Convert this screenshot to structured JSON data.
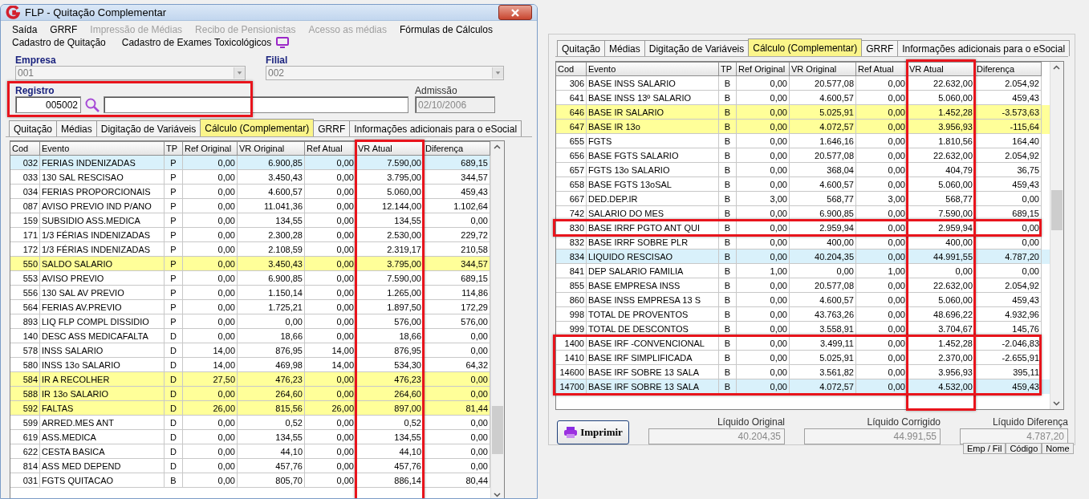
{
  "left_window": {
    "title": "FLP - Quitação Complementar",
    "menu": [
      {
        "label": "Saída",
        "disabled": false
      },
      {
        "label": "GRRF",
        "disabled": false
      },
      {
        "label": "Impressão de Médias",
        "disabled": true
      },
      {
        "label": "Recibo de Pensionistas",
        "disabled": true
      },
      {
        "label": "Acesso as médias",
        "disabled": true
      },
      {
        "label": "Fórmulas de Cálculos",
        "disabled": false
      }
    ],
    "links": [
      "Cadastro de Quitação",
      "Cadastro de Exames Toxicológicos"
    ],
    "empresa": {
      "label": "Empresa",
      "value": "001"
    },
    "filial": {
      "label": "Filial",
      "value": "002"
    },
    "registro": {
      "label": "Registro",
      "value": "005002",
      "boxed": true
    },
    "admissao": {
      "label": "Admissão",
      "value": "02/10/2006"
    },
    "tabs": [
      {
        "label": "Quitação",
        "selected": false
      },
      {
        "label": "Médias",
        "selected": false
      },
      {
        "label": "Digitação de Variáveis",
        "selected": false
      },
      {
        "label": "Cálculo (Complementar)",
        "selected": true
      },
      {
        "label": "GRRF",
        "selected": false
      },
      {
        "label": "Informações adicionais para o eSocial",
        "selected": false
      }
    ],
    "table": {
      "columns": [
        {
          "label": "Cod",
          "boxed": false
        },
        {
          "label": "Evento",
          "boxed": false
        },
        {
          "label": "TP",
          "boxed": false
        },
        {
          "label": "Ref Original",
          "boxed": false
        },
        {
          "label": "VR Original",
          "boxed": false
        },
        {
          "label": "Ref Atual",
          "boxed": false
        },
        {
          "label": "VR Atual",
          "boxed": true
        },
        {
          "label": "Diferença",
          "boxed": false
        }
      ],
      "rows": [
        {
          "cells": [
            "032",
            "FERIAS INDENIZADAS",
            "P",
            "0,00",
            "6.900,85",
            "0,00",
            "7.590,00",
            "689,15"
          ],
          "color": "#d9f1fb"
        },
        {
          "cells": [
            "033",
            "130 SAL RESCISAO",
            "P",
            "0,00",
            "3.450,43",
            "0,00",
            "3.795,00",
            "344,57"
          ],
          "color": "#ffffff"
        },
        {
          "cells": [
            "034",
            "FERIAS PROPORCIONAIS",
            "P",
            "0,00",
            "4.600,57",
            "0,00",
            "5.060,00",
            "459,43"
          ],
          "color": "#ffffff"
        },
        {
          "cells": [
            "087",
            "AVISO PREVIO IND P/ANO",
            "P",
            "0,00",
            "11.041,36",
            "0,00",
            "12.144,00",
            "1.102,64"
          ],
          "color": "#ffffff"
        },
        {
          "cells": [
            "159",
            "SUBSIDIO ASS.MEDICA",
            "P",
            "0,00",
            "134,55",
            "0,00",
            "134,55",
            "0,00"
          ],
          "color": "#ffffff"
        },
        {
          "cells": [
            "171",
            "1/3 FÉRIAS INDENIZADAS",
            "P",
            "0,00",
            "2.300,28",
            "0,00",
            "2.530,00",
            "229,72"
          ],
          "color": "#ffffff"
        },
        {
          "cells": [
            "172",
            "1/3 FÉRIAS INDENIZADAS",
            "P",
            "0,00",
            "2.108,59",
            "0,00",
            "2.319,17",
            "210,58"
          ],
          "color": "#ffffff"
        },
        {
          "cells": [
            "550",
            "SALDO SALARIO",
            "P",
            "0,00",
            "3.450,43",
            "0,00",
            "3.795,00",
            "344,57"
          ],
          "color": "#ffff99"
        },
        {
          "cells": [
            "553",
            "AVISO PREVIO",
            "P",
            "0,00",
            "6.900,85",
            "0,00",
            "7.590,00",
            "689,15"
          ],
          "color": "#ffffff"
        },
        {
          "cells": [
            "556",
            "130 SAL AV PREVIO",
            "P",
            "0,00",
            "1.150,14",
            "0,00",
            "1.265,00",
            "114,86"
          ],
          "color": "#ffffff"
        },
        {
          "cells": [
            "564",
            "FERIAS AV.PREVIO",
            "P",
            "0,00",
            "1.725,21",
            "0,00",
            "1.897,50",
            "172,29"
          ],
          "color": "#ffffff"
        },
        {
          "cells": [
            "893",
            "LIQ FLP COMPL DISSIDIO",
            "P",
            "0,00",
            "0,00",
            "0,00",
            "576,00",
            "576,00"
          ],
          "color": "#ffffff"
        },
        {
          "cells": [
            "140",
            "DESC ASS MEDICAFALTA",
            "D",
            "0,00",
            "18,66",
            "0,00",
            "18,66",
            "0,00"
          ],
          "color": "#ffffff"
        },
        {
          "cells": [
            "578",
            "INSS SALARIO",
            "D",
            "14,00",
            "876,95",
            "14,00",
            "876,95",
            "0,00"
          ],
          "color": "#ffffff"
        },
        {
          "cells": [
            "580",
            "INSS 13o SALARIO",
            "D",
            "14,00",
            "469,98",
            "14,00",
            "534,30",
            "64,32"
          ],
          "color": "#ffffff"
        },
        {
          "cells": [
            "584",
            "IR A RECOLHER",
            "D",
            "27,50",
            "476,23",
            "0,00",
            "476,23",
            "0,00"
          ],
          "color": "#ffff99"
        },
        {
          "cells": [
            "588",
            "IR 13o SALARIO",
            "D",
            "0,00",
            "264,60",
            "0,00",
            "264,60",
            "0,00"
          ],
          "color": "#ffff99"
        },
        {
          "cells": [
            "592",
            "FALTAS",
            "D",
            "26,00",
            "815,56",
            "26,00",
            "897,00",
            "81,44"
          ],
          "color": "#ffff99"
        },
        {
          "cells": [
            "599",
            "ARRED.MES ANT",
            "D",
            "0,00",
            "0,52",
            "0,00",
            "0,52",
            "0,00"
          ],
          "color": "#ffffff"
        },
        {
          "cells": [
            "619",
            "ASS.MEDICA",
            "D",
            "0,00",
            "134,55",
            "0,00",
            "134,55",
            "0,00"
          ],
          "color": "#ffffff"
        },
        {
          "cells": [
            "622",
            "CESTA BASICA",
            "D",
            "0,00",
            "44,10",
            "0,00",
            "44,10",
            "0,00"
          ],
          "color": "#ffffff"
        },
        {
          "cells": [
            "814",
            "ASS MED DEPEND",
            "D",
            "0,00",
            "457,76",
            "0,00",
            "457,76",
            "0,00"
          ],
          "color": "#ffffff"
        },
        {
          "cells": [
            "031",
            "FGTS QUITACAO",
            "B",
            "0,00",
            "805,70",
            "0,00",
            "886,14",
            "80,44"
          ],
          "color": "#ffffff"
        }
      ]
    }
  },
  "right_panel": {
    "tabs": [
      {
        "label": "Quitação",
        "selected": false
      },
      {
        "label": "Médias",
        "selected": false
      },
      {
        "label": "Digitação de Variáveis",
        "selected": false
      },
      {
        "label": "Cálculo (Complementar)",
        "selected": true
      },
      {
        "label": "GRRF",
        "selected": false
      },
      {
        "label": "Informações adicionais para o eSocial",
        "selected": false
      }
    ],
    "table": {
      "columns": [
        {
          "label": "Cod",
          "boxed": false
        },
        {
          "label": "Evento",
          "boxed": false
        },
        {
          "label": "TP",
          "boxed": false
        },
        {
          "label": "Ref Original",
          "boxed": false
        },
        {
          "label": "VR Original",
          "boxed": false
        },
        {
          "label": "Ref Atual",
          "boxed": false
        },
        {
          "label": "VR Atual",
          "boxed": true
        },
        {
          "label": "Diferença",
          "boxed": false
        }
      ],
      "rows": [
        {
          "cells": [
            "306",
            "BASE INSS SALARIO",
            "B",
            "0,00",
            "20.577,08",
            "0,00",
            "22.632,00",
            "2.054,92"
          ],
          "color": "#ffffff",
          "boxed": false
        },
        {
          "cells": [
            "641",
            "BASE INSS 13º SALARIO",
            "B",
            "0,00",
            "4.600,57",
            "0,00",
            "5.060,00",
            "459,43"
          ],
          "color": "#ffffff",
          "boxed": false
        },
        {
          "cells": [
            "646",
            "BASE IR SALARIO",
            "B",
            "0,00",
            "5.025,91",
            "0,00",
            "1.452,28",
            "-3.573,63"
          ],
          "color": "#ffff99",
          "boxed": false
        },
        {
          "cells": [
            "647",
            "BASE IR 13o",
            "B",
            "0,00",
            "4.072,57",
            "0,00",
            "3.956,93",
            "-115,64"
          ],
          "color": "#ffff99",
          "boxed": false
        },
        {
          "cells": [
            "655",
            "FGTS",
            "B",
            "0,00",
            "1.646,16",
            "0,00",
            "1.810,56",
            "164,40"
          ],
          "color": "#ffffff",
          "boxed": false
        },
        {
          "cells": [
            "656",
            "BASE FGTS SALARIO",
            "B",
            "0,00",
            "20.577,08",
            "0,00",
            "22.632,00",
            "2.054,92"
          ],
          "color": "#ffffff",
          "boxed": false
        },
        {
          "cells": [
            "657",
            "FGTS 13o SALARIO",
            "B",
            "0,00",
            "368,04",
            "0,00",
            "404,79",
            "36,75"
          ],
          "color": "#ffffff",
          "boxed": false
        },
        {
          "cells": [
            "658",
            "BASE FGTS 13oSAL",
            "B",
            "0,00",
            "4.600,57",
            "0,00",
            "5.060,00",
            "459,43"
          ],
          "color": "#ffffff",
          "boxed": false
        },
        {
          "cells": [
            "667",
            "DED.DEP.IR",
            "B",
            "3,00",
            "568,77",
            "3,00",
            "568,77",
            "0,00"
          ],
          "color": "#ffffff",
          "boxed": false
        },
        {
          "cells": [
            "742",
            "SALARIO DO MES",
            "B",
            "0,00",
            "6.900,85",
            "0,00",
            "7.590,00",
            "689,15"
          ],
          "color": "#ffffff",
          "boxed": false
        },
        {
          "cells": [
            "830",
            "BASE IRRF PGTO ANT QUI",
            "B",
            "0,00",
            "2.959,94",
            "0,00",
            "2.959,94",
            "0,00"
          ],
          "color": "#ffffff",
          "boxed": true
        },
        {
          "cells": [
            "832",
            "BASE IRRF SOBRE PLR",
            "B",
            "0,00",
            "400,00",
            "0,00",
            "400,00",
            "0,00"
          ],
          "color": "#ffffff",
          "boxed": false
        },
        {
          "cells": [
            "834",
            "LIQUIDO RESCISAO",
            "B",
            "0,00",
            "40.204,35",
            "0,00",
            "44.991,55",
            "4.787,20"
          ],
          "color": "#d9f1fb",
          "boxed": false
        },
        {
          "cells": [
            "841",
            "DEP SALARIO FAMILIA",
            "B",
            "1,00",
            "0,00",
            "1,00",
            "0,00",
            "0,00"
          ],
          "color": "#ffffff",
          "boxed": false
        },
        {
          "cells": [
            "855",
            "BASE EMPRESA INSS",
            "B",
            "0,00",
            "20.577,08",
            "0,00",
            "22.632,00",
            "2.054,92"
          ],
          "color": "#ffffff",
          "boxed": false
        },
        {
          "cells": [
            "860",
            "BASE INSS EMPRESA 13 S",
            "B",
            "0,00",
            "4.600,57",
            "0,00",
            "5.060,00",
            "459,43"
          ],
          "color": "#ffffff",
          "boxed": false
        },
        {
          "cells": [
            "998",
            "TOTAL DE PROVENTOS",
            "B",
            "0,00",
            "43.763,26",
            "0,00",
            "48.696,22",
            "4.932,96"
          ],
          "color": "#ffffff",
          "boxed": false
        },
        {
          "cells": [
            "999",
            "TOTAL DE DESCONTOS",
            "B",
            "0,00",
            "3.558,91",
            "0,00",
            "3.704,67",
            "145,76"
          ],
          "color": "#ffffff",
          "boxed": false
        },
        {
          "cells": [
            "1400",
            "BASE IRF -CONVENCIONAL",
            "B",
            "0,00",
            "3.499,11",
            "0,00",
            "1.452,28",
            "-2.046,83"
          ],
          "color": "#ffffff",
          "boxed": true
        },
        {
          "cells": [
            "1410",
            "BASE IRF SIMPLIFICADA",
            "B",
            "0,00",
            "5.025,91",
            "0,00",
            "2.370,00",
            "-2.655,91"
          ],
          "color": "#ffffff",
          "boxed": true
        },
        {
          "cells": [
            "14600",
            "BASE IRF SOBRE 13 SALA",
            "B",
            "0,00",
            "3.561,82",
            "0,00",
            "3.956,93",
            "395,11"
          ],
          "color": "#ffffff",
          "boxed": true
        },
        {
          "cells": [
            "14700",
            "BASE IRF SOBRE 13 SALA",
            "B",
            "0,00",
            "4.072,57",
            "0,00",
            "4.532,00",
            "459,43"
          ],
          "color": "#d9f1fb",
          "boxed": true
        }
      ]
    },
    "print_button": "Imprimir",
    "totals": [
      {
        "label": "Líquido Original",
        "value": "40.204,35"
      },
      {
        "label": "Líquido Corrigido",
        "value": "44.991,55"
      },
      {
        "label": "Líquido Diferença",
        "value": "4.787,20"
      }
    ]
  },
  "background_grid": {
    "columns": [
      "Emp / Fil",
      "Código",
      "Nome"
    ]
  }
}
